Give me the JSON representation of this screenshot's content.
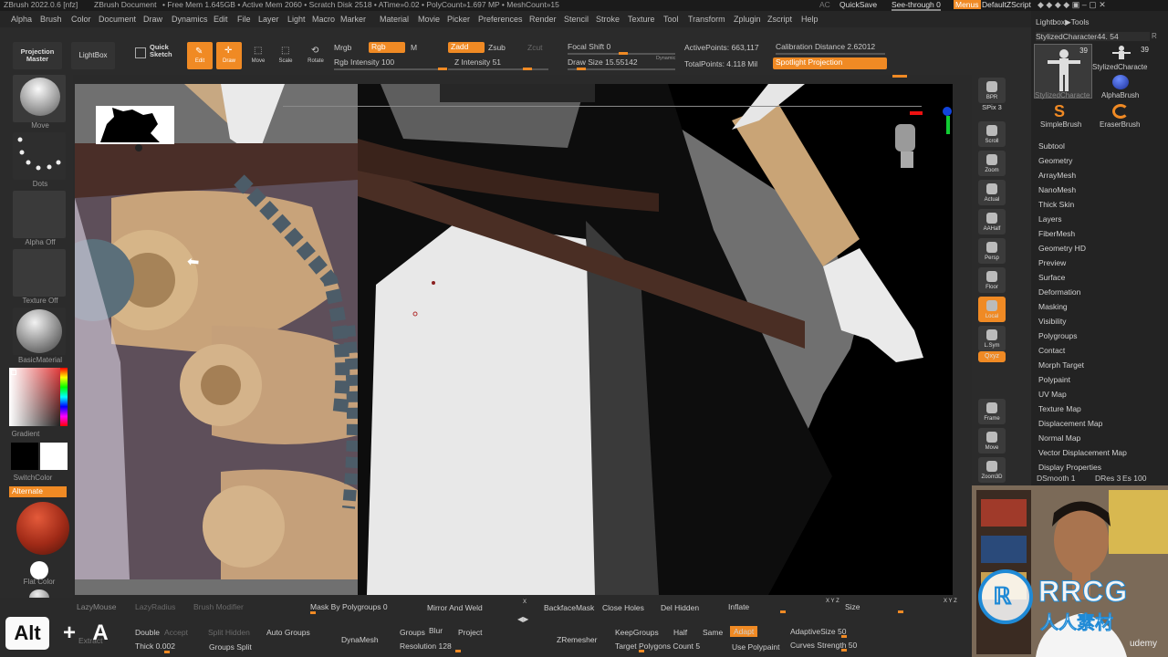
{
  "titlebar": {
    "app": "ZBrush 2022.0.6 [nfz]",
    "document": "ZBrush Document",
    "stats": "• Free Mem 1.645GB • Active Mem 2060 • Scratch Disk 2518 • ATime»0.02 • PolyCount»1.697 MP • MeshCount»15",
    "ac": "AC",
    "quicksave": "QuickSave",
    "seethrough": "See-through 0",
    "menus": "Menus",
    "zscript": "DefaultZScript"
  },
  "menus": [
    "Alpha",
    "Brush",
    "Color",
    "Document",
    "Draw",
    "Dynamics",
    "Edit",
    "File",
    "Layer",
    "Light",
    "Macro",
    "Marker",
    "Material",
    "Movie",
    "Picker",
    "Preferences",
    "Render",
    "Stencil",
    "Stroke",
    "Texture",
    "Tool",
    "Transform",
    "Zplugin",
    "Zscript",
    "Help"
  ],
  "topshelf": {
    "projection_master": "Projection Master",
    "lightbox": "LightBox",
    "quick_sketch": "Quick Sketch",
    "edit": "Edit",
    "draw": "Draw",
    "move": "Move",
    "scale": "Scale",
    "rotate": "Rotate",
    "mrgb": "Mrgb",
    "rgb": "Rgb",
    "m": "M",
    "rgb_intensity": "Rgb Intensity 100",
    "zadd": "Zadd",
    "zsub": "Zsub",
    "zcut": "Zcut",
    "z_intensity": "Z Intensity 51",
    "focal_shift": "Focal Shift 0",
    "draw_size": "Draw Size 15.55142",
    "dynamic": "Dynamic",
    "active_points": "ActivePoints: 663,117",
    "total_points": "TotalPoints: 4.118 Mil",
    "calibration": "Calibration Distance 2.62012",
    "spotlight": "Spotlight Projection"
  },
  "leftshelf": {
    "move": "Move",
    "dots": "Dots",
    "alpha_off": "Alpha Off",
    "texture_off": "Texture Off",
    "material": "BasicMaterial",
    "gradient": "Gradient",
    "switchcolor": "SwitchColor",
    "alternate": "Alternate",
    "flat_color": "Flat Color"
  },
  "rightshelf": [
    "BPR",
    "SPix 3",
    "Scroll",
    "Zoom",
    "Actual",
    "AAHalf",
    "Persp",
    "Floor",
    "Local",
    "L.Sym",
    "Qxyz",
    "",
    "Frame",
    "Move",
    "Zoom3D"
  ],
  "tray": {
    "header": "Lightbox▶Tools",
    "tool_name": "StylizedCharacter44. 54",
    "r": "R",
    "thumbs": [
      {
        "label": "StylizedCharacte",
        "count": "39"
      },
      {
        "label": "StylizedCharacte",
        "count": "39"
      },
      {
        "label": "AlphaBrush",
        "count": ""
      },
      {
        "label": "SimpleBrush",
        "count": ""
      },
      {
        "label": "EraserBrush",
        "count": ""
      }
    ],
    "items": [
      "Subtool",
      "Geometry",
      "ArrayMesh",
      "NanoMesh",
      "Thick Skin",
      "Layers",
      "FiberMesh",
      "Geometry HD",
      "Preview",
      "Surface",
      "Deformation",
      "Masking",
      "Visibility",
      "Polygroups",
      "Contact",
      "Morph Target",
      "Polypaint",
      "UV Map",
      "Texture Map",
      "Displacement Map",
      "Normal Map",
      "Vector Displacement Map",
      "Display Properties"
    ],
    "dsmooth": "DSmooth 1",
    "dres": "DRes 3",
    "es": "Es 100"
  },
  "bottomshelf": {
    "lazymouse": "LazyMouse",
    "lazyradius": "LazyRadius",
    "brush_modifier": "Brush Modifier",
    "mask_by_polygroups": "Mask By Polygroups 0",
    "mirror_weld": "Mirror And Weld",
    "backface": "BackfaceMask",
    "close_holes": "Close Holes",
    "del_hidden": "Del Hidden",
    "inflate": "Inflate",
    "size": "Size",
    "double": "Double",
    "accept": "Accept",
    "split_hidden": "Split Hidden",
    "auto_groups": "Auto Groups",
    "thick": "Thick 0.002",
    "groups_split": "Groups Split",
    "dynamesh": "DynaMesh",
    "groups": "Groups",
    "blur": "Blur",
    "project": "Project",
    "resolution": "Resolution 128",
    "zremesher": "ZRemesher",
    "keepgroups": "KeepGroups",
    "half": "Half",
    "same": "Same",
    "adapt": "Adapt",
    "target_polygons": "Target Polygons Count 5",
    "use_polypaint": "Use Polypaint",
    "adaptive_size": "AdaptiveSize 50",
    "curves_strength": "Curves Strength 50",
    "extract": "Extract"
  },
  "overlay": {
    "key_alt": "Alt",
    "plus": "+",
    "key_a": "A",
    "watermark_main": "RRCG",
    "watermark_sub": "人人素材",
    "udemy": "udemy"
  }
}
